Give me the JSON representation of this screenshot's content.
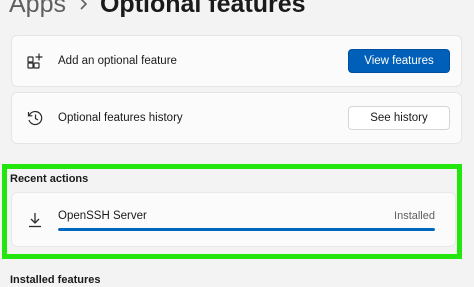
{
  "breadcrumb": {
    "parent": "Apps",
    "current": "Optional features"
  },
  "add_feature": {
    "label": "Add an optional feature",
    "button": "View features"
  },
  "history": {
    "label": "Optional features history",
    "button": "See history"
  },
  "recent_actions": {
    "title": "Recent actions",
    "items": [
      {
        "name": "OpenSSH Server",
        "status": "Installed",
        "progress": 1.0,
        "icon": "download-icon"
      }
    ]
  },
  "installed_features": {
    "title": "Installed features"
  },
  "colors": {
    "accent": "#005fb8",
    "highlight": "#22e60e",
    "progress": "#0067c0"
  }
}
